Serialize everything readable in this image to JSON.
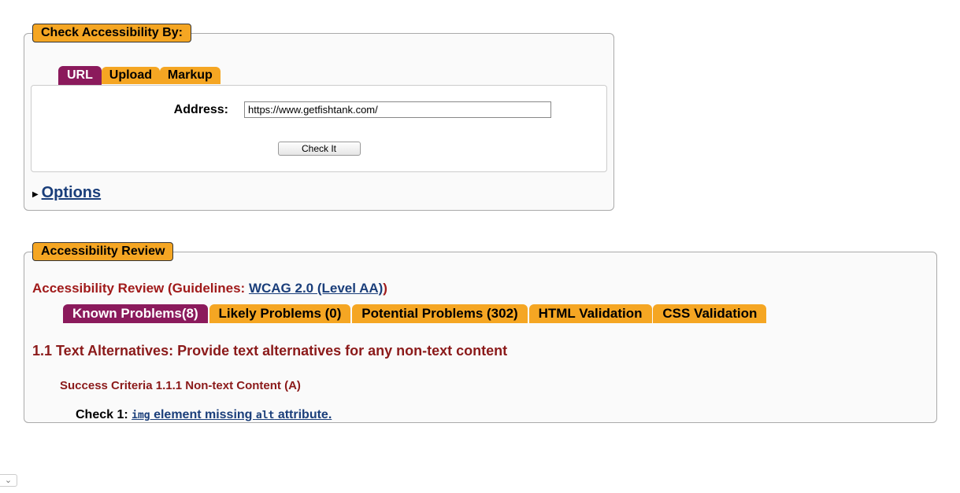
{
  "check_section": {
    "legend": "Check Accessibility By:",
    "tabs": {
      "url": "URL",
      "upload": "Upload",
      "markup": "Markup"
    },
    "address_label": "Address:",
    "address_value": "https://www.getfishtank.com/",
    "check_button": "Check It",
    "options_link": "Options"
  },
  "review_section": {
    "legend": "Accessibility Review",
    "header_prefix": "Accessibility Review (Guidelines: ",
    "guidelines_link": "WCAG 2.0 (Level AA)",
    "header_suffix": ")",
    "tabs": {
      "known": "Known Problems(8)",
      "likely": "Likely Problems (0)",
      "potential": "Potential Problems (302)",
      "html": "HTML Validation",
      "css": "CSS Validation"
    },
    "section_heading": "1.1 Text Alternatives: Provide text alternatives for any non-text content",
    "criteria": "Success Criteria 1.1.1 Non-text Content (A)",
    "check_label": "Check 1: ",
    "check_link_part1": "img",
    "check_link_part2": " element missing ",
    "check_link_part3": "alt",
    "check_link_part4": " attribute."
  },
  "chevron": "⌄"
}
